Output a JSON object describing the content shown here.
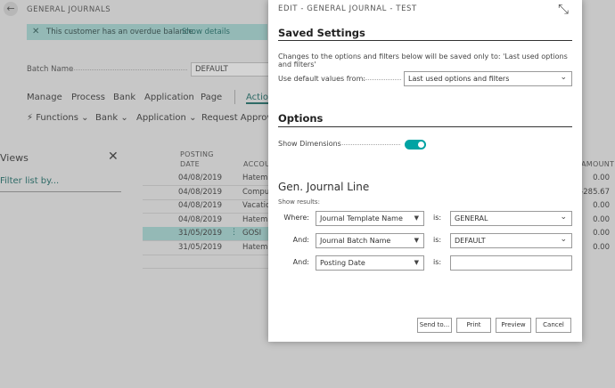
{
  "background": {
    "page_title": "GENERAL JOURNALS",
    "banner": {
      "message": "This customer has an overdue balance.",
      "link": "Show details"
    },
    "batch": {
      "label": "Batch Name",
      "value": "DEFAULT"
    },
    "menu1": [
      "Manage",
      "Process",
      "Bank",
      "Application",
      "Page",
      "Actio"
    ],
    "menu2": [
      "Functions",
      "Bank",
      "Application",
      "Request Approval"
    ],
    "views": {
      "title": "Views",
      "filter_link": "Filter list by..."
    },
    "columns": {
      "posting": "POSTING",
      "date": "DATE",
      "account": "ACCOU",
      "amount": "AMOUNT"
    },
    "rows": [
      {
        "date": "04/08/2019",
        "account": "Hatem A",
        "amount": "0.00",
        "selected": false
      },
      {
        "date": "04/08/2019",
        "account": "Comput",
        "amount": "-285.67",
        "selected": false
      },
      {
        "date": "04/08/2019",
        "account": "Vacatio",
        "amount": "0.00",
        "selected": false
      },
      {
        "date": "04/08/2019",
        "account": "Hatem A",
        "amount": "0.00",
        "selected": false
      },
      {
        "date": "31/05/2019",
        "account": "GOSI",
        "amount": "0.00",
        "selected": true
      },
      {
        "date": "31/05/2019",
        "account": "Hatem A",
        "amount": "0.00",
        "selected": false
      }
    ]
  },
  "dialog": {
    "title": "EDIT - GENERAL JOURNAL - TEST",
    "saved_settings": {
      "heading": "Saved Settings",
      "note": "Changes to the options and filters below will be saved only to: 'Last used options and filters'",
      "default_label": "Use default values from:",
      "default_value": "Last used options and filters"
    },
    "options": {
      "heading": "Options",
      "show_dimensions_label": "Show Dimensions",
      "show_dimensions_on": true
    },
    "gen_journal_line": {
      "heading": "Gen. Journal Line",
      "show_results": "Show results:",
      "filters": [
        {
          "prefix": "Where:",
          "field": "Journal Template Name",
          "is": "is:",
          "value": "GENERAL",
          "has_dropdown": true
        },
        {
          "prefix": "And:",
          "field": "Journal Batch Name",
          "is": "is:",
          "value": "DEFAULT",
          "has_dropdown": true
        },
        {
          "prefix": "And:",
          "field": "Posting Date",
          "is": "is:",
          "value": "",
          "has_dropdown": false
        }
      ]
    },
    "buttons": {
      "send_to": "Send to...",
      "print": "Print",
      "preview": "Preview",
      "cancel": "Cancel"
    }
  },
  "icons": {
    "back": "arrow-left-icon",
    "close": "close-icon",
    "expand": "expand-icon",
    "chevron": "chevron-down-icon"
  }
}
